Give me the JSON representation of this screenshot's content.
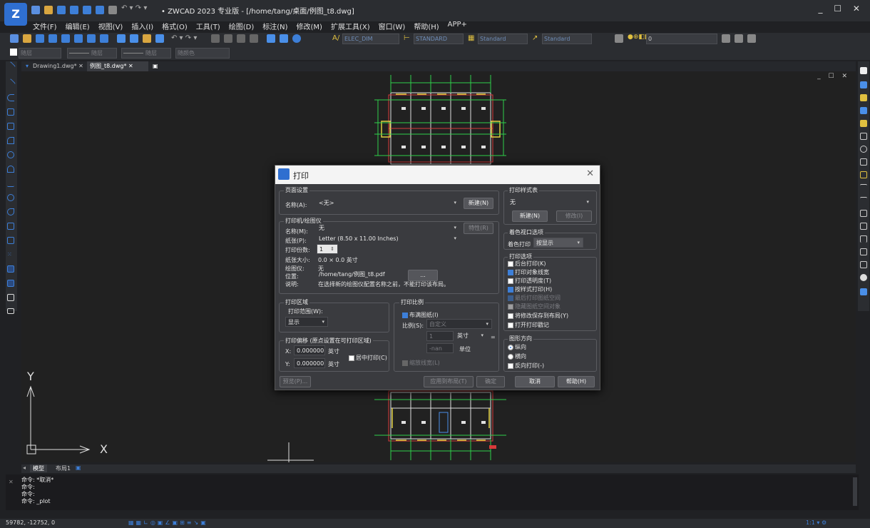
{
  "title": "• ZWCAD 2023 专业版 - [/home/tang/桌面/例图_t8.dwg]",
  "window_controls": "_ ☐ ✕",
  "menu": [
    "文件(F)",
    "编辑(E)",
    "视图(V)",
    "插入(I)",
    "格式(O)",
    "工具(T)",
    "绘图(D)",
    "标注(N)",
    "修改(M)",
    "扩展工具(X)",
    "窗口(W)",
    "帮助(H)",
    "APP+"
  ],
  "toolbar": {
    "dimstyle": "ELEC_DIM",
    "textstyle": "STANDARD",
    "tablestyle": "Standard",
    "mleaderstyle": "Standard",
    "layer": "0",
    "color": "随层",
    "linetype": "随层",
    "lineweight": "随层",
    "plotstyle": "随颜色"
  },
  "doc_tabs": [
    "Drawing1.dwg*",
    "例图_t8.dwg*"
  ],
  "canvas_controls": "_ ☐ ✕",
  "ucs": {
    "x": "X",
    "y": "Y"
  },
  "layout_tabs": [
    "模型",
    "布局1"
  ],
  "command_lines": [
    "命令: *取消*",
    "命令:",
    "命令:",
    "命令: _plot"
  ],
  "status": {
    "coords": "59782, -12752, 0",
    "scale": "1:1"
  },
  "dialog": {
    "title": "打印",
    "close": "✕",
    "page_setup": {
      "group": "页面设置",
      "name_label": "名称(A):",
      "name_value": "<无>",
      "new_btn": "新建(N)"
    },
    "printer": {
      "group": "打印机/绘图仪",
      "name_label": "名称(M):",
      "name_value": "无",
      "props_btn": "特性(R)",
      "paper_label": "纸张(P):",
      "paper_value": "Letter (8.50 x 11.00 Inches)",
      "copies_label": "打印份数:",
      "copies_value": "1",
      "size_label": "纸张大小:",
      "size_value": "0.0 × 0.0  英寸",
      "plotter_label": "绘图仪:",
      "plotter_value": "无",
      "location_label": "位置:",
      "location_value": "/home/tang/例图_t8.pdf",
      "browse_btn": "...",
      "desc_label": "说明:",
      "desc_value": "在选择新的绘图仪配置名称之前，不能打印该布局。"
    },
    "area": {
      "group": "打印区域",
      "range_label": "打印范围(W):",
      "range_value": "显示"
    },
    "offset": {
      "group": "打印偏移 (原点设置在可打印区域)",
      "x_label": "X:",
      "x_value": "0.000000",
      "x_unit": "英寸",
      "y_label": "Y:",
      "y_value": "0.000000",
      "y_unit": "英寸",
      "center_label": "居中打印(C)"
    },
    "scale": {
      "group": "打印比例",
      "fit_label": "布满图纸(I)",
      "scale_label": "比例(S):",
      "scale_value": "自定义",
      "v1": "1",
      "u1": "英寸",
      "eq": "=",
      "v2": "-nan",
      "u2": "单位",
      "lw_label": "缩放线宽(L)"
    },
    "style_table": {
      "group": "打印样式表",
      "value": "无",
      "new_btn": "新建(N)",
      "edit_btn": "修改(I)"
    },
    "shaded": {
      "group": "着色视口选项",
      "label": "着色打印",
      "value": "按显示"
    },
    "options": {
      "group": "打印选项",
      "items": [
        "后台打印(K)",
        "打印对象线宽",
        "打印透明度(T)",
        "按样式打印(H)",
        "最后打印图纸空间",
        "隐藏图纸空间对象",
        "将修改保存到布局(Y)",
        "打开打印戳记"
      ]
    },
    "orientation": {
      "group": "图形方向",
      "portrait": "纵向",
      "landscape": "横向",
      "reverse": "反向打印(-)"
    },
    "buttons": {
      "preview": "预览(P)...",
      "apply": "应用到布局(T)",
      "ok": "确定",
      "cancel": "取消",
      "help": "帮助(H)"
    }
  },
  "colors": {
    "accent": "#3d7fd8",
    "drawing_wall": "#e0e0e0",
    "drawing_red": "#d83a3a",
    "drawing_green": "#2fd04a",
    "drawing_yellow": "#e0d040",
    "drawing_magenta": "#d050a0"
  }
}
